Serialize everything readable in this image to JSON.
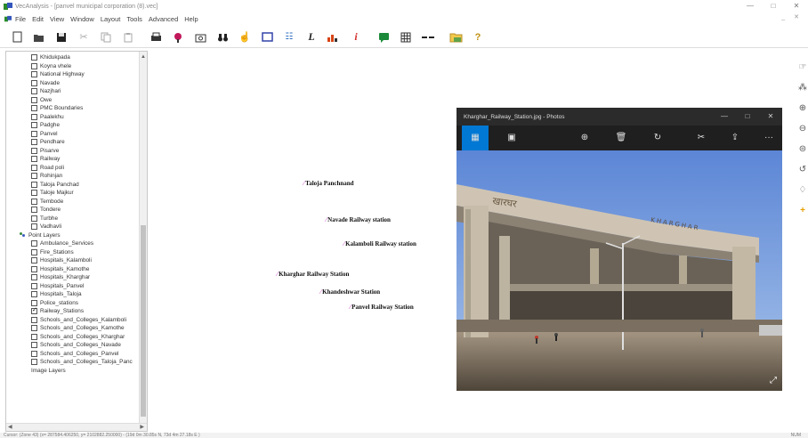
{
  "window": {
    "title": "VecAnalysis - [panvel municipal corporation (8).vec]",
    "min": "—",
    "max": "□",
    "close": "✕"
  },
  "menu": [
    "File",
    "Edit",
    "View",
    "Window",
    "Layout",
    "Tools",
    "Advanced",
    "Help"
  ],
  "doc_controls": "_ ✕",
  "toolbar_icons": [
    "new-icon",
    "open-icon",
    "save-icon",
    "cut-icon",
    "copy-icon",
    "paste-icon",
    "print-icon",
    "pin-icon",
    "camera-icon",
    "binoculars-icon",
    "pointer-icon",
    "rectangle-icon",
    "filter-icon",
    "italic-l-icon",
    "chart-icon",
    "info-icon",
    "comment-icon",
    "grid-icon",
    "dash-icon",
    "folder-icon",
    "help-icon"
  ],
  "layers": {
    "lines_items": [
      {
        "label": "Khidukpada",
        "checked": false
      },
      {
        "label": "Koyna vhele",
        "checked": false
      },
      {
        "label": "National Highway",
        "checked": false
      },
      {
        "label": "Navade",
        "checked": false
      },
      {
        "label": "Nazjhari",
        "checked": false
      },
      {
        "label": "Owe",
        "checked": false
      },
      {
        "label": "PMC Boundaries",
        "checked": false
      },
      {
        "label": "Paalekhu",
        "checked": false
      },
      {
        "label": "Padghe",
        "checked": false
      },
      {
        "label": "Panvel",
        "checked": false
      },
      {
        "label": "Pendhare",
        "checked": false
      },
      {
        "label": "Pisarve",
        "checked": false
      },
      {
        "label": "Railway",
        "checked": false
      },
      {
        "label": "Road poli",
        "checked": false
      },
      {
        "label": "Rohinjan",
        "checked": false
      },
      {
        "label": "Taloja Panchad",
        "checked": false
      },
      {
        "label": "Taloje Majkur",
        "checked": false
      },
      {
        "label": "Tembode",
        "checked": false
      },
      {
        "label": "Tondere",
        "checked": false
      },
      {
        "label": "Turbhe",
        "checked": false
      },
      {
        "label": "Vadhavli",
        "checked": false
      }
    ],
    "point_group": "Point Layers",
    "point_items": [
      {
        "label": "Ambulance_Services",
        "checked": false
      },
      {
        "label": "Fire_Stations",
        "checked": false
      },
      {
        "label": "Hospitals_Kalamboli",
        "checked": false
      },
      {
        "label": "Hospitals_Kamothe",
        "checked": false
      },
      {
        "label": "Hospitals_Kharghar",
        "checked": false
      },
      {
        "label": "Hospitals_Panvel",
        "checked": false
      },
      {
        "label": "Hospitals_Taloja",
        "checked": false
      },
      {
        "label": "Police_stations",
        "checked": false
      },
      {
        "label": "Railway_Stations",
        "checked": true
      },
      {
        "label": "Schools_and_Colleges_Kalamboli",
        "checked": false
      },
      {
        "label": "Schools_and_Colleges_Kamothe",
        "checked": false
      },
      {
        "label": "Schools_and_Colleges_Kharghar",
        "checked": false
      },
      {
        "label": "Schools_and_Colleges_Navade",
        "checked": false
      },
      {
        "label": "Schools_and_Colleges_Panvel",
        "checked": false
      },
      {
        "label": "Schools_and_Colleges_Taloja_Panc",
        "checked": false
      }
    ],
    "image_group": "Image Layers"
  },
  "stations": [
    {
      "name": "Taloja Panchnand"
    },
    {
      "name": "Navade Railway station"
    },
    {
      "name": "Kalamboli Railway station"
    },
    {
      "name": "Kharghar Railway Station"
    },
    {
      "name": "Khandeshwar Station"
    },
    {
      "name": "Panvel Railway Station"
    }
  ],
  "photos": {
    "title": "Kharghar_Railway_Station.jpg - Photos",
    "sign_text": "KHARGHAR",
    "sign_text_hindi": "खारघर",
    "more": "···"
  },
  "status": {
    "left": "Cursor: (Zone 43) (x= 287584.406250, y= 2102882.250000) - (19d 0m 30.85s N, 73d 4m 27.18s E )",
    "right": "NUM"
  }
}
